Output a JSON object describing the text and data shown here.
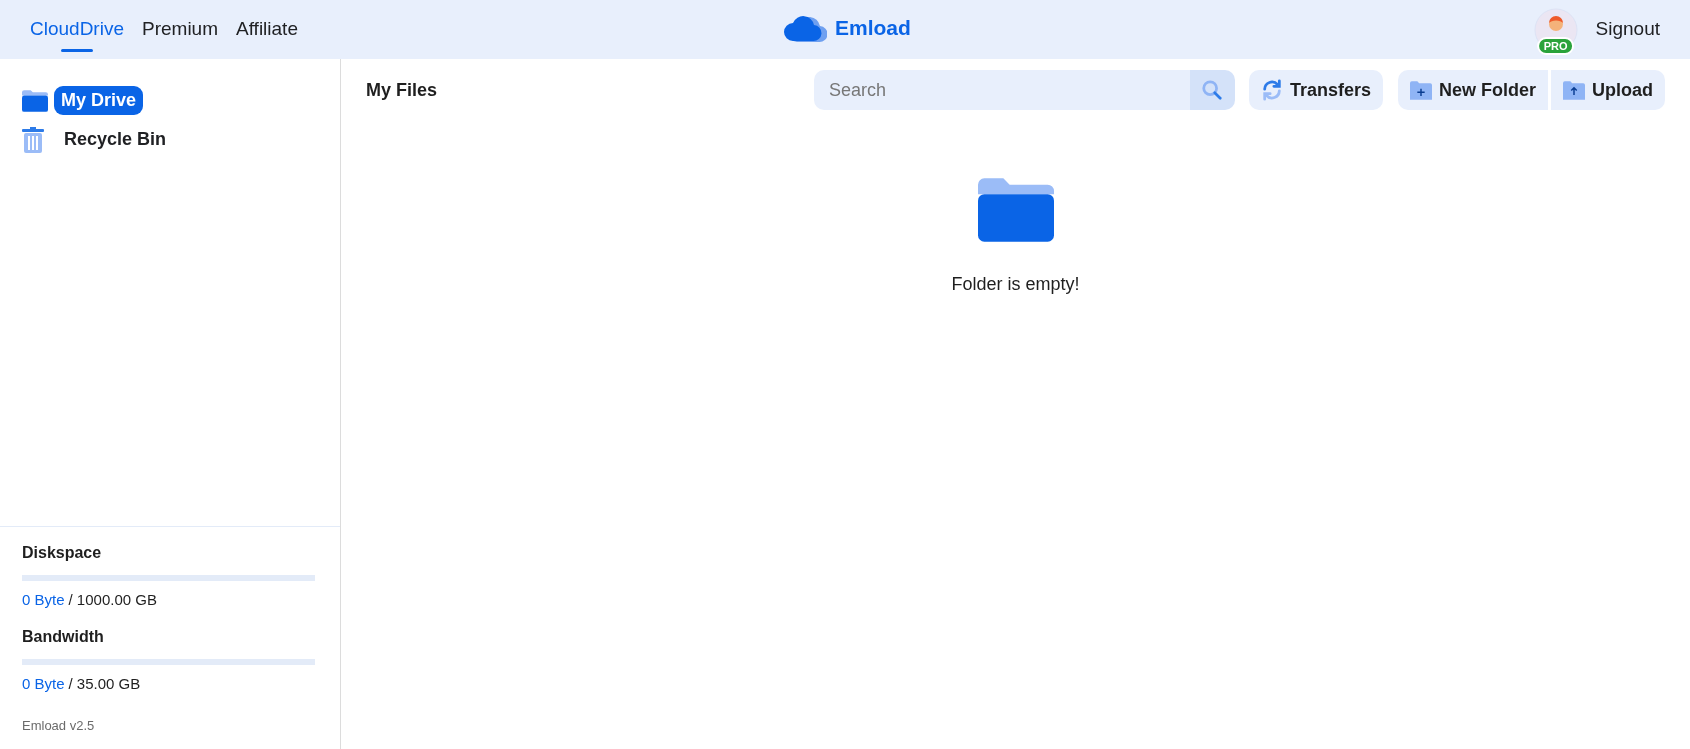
{
  "nav": {
    "tabs": [
      {
        "label": "CloudDrive",
        "selected": true
      },
      {
        "label": "Premium",
        "selected": false
      },
      {
        "label": "Affiliate",
        "selected": false
      }
    ],
    "brand": "Emload",
    "badge": "PRO",
    "signout": "Signout"
  },
  "sidebar": {
    "items": [
      {
        "label": "My Drive",
        "kind": "folder",
        "selected": true
      },
      {
        "label": "Recycle Bin",
        "kind": "trash",
        "selected": false
      }
    ],
    "meters": [
      {
        "title": "Diskspace",
        "level": 0,
        "used": "0 Byte",
        "total": "/ 1000.00 GB"
      },
      {
        "title": "Bandwidth",
        "level": 0,
        "used": "0 Byte",
        "total": "/ 35.00 GB"
      }
    ],
    "version": "Emload v2.5"
  },
  "main": {
    "title": "My Files",
    "search": {
      "placeholder": "Search"
    },
    "buttons": [
      {
        "label": "Transfers",
        "kind": "transfers"
      },
      {
        "label": "New Folder",
        "kind": "new-folder"
      },
      {
        "label": "Upload",
        "kind": "upload"
      }
    ],
    "empty_message": "Folder is empty!"
  }
}
